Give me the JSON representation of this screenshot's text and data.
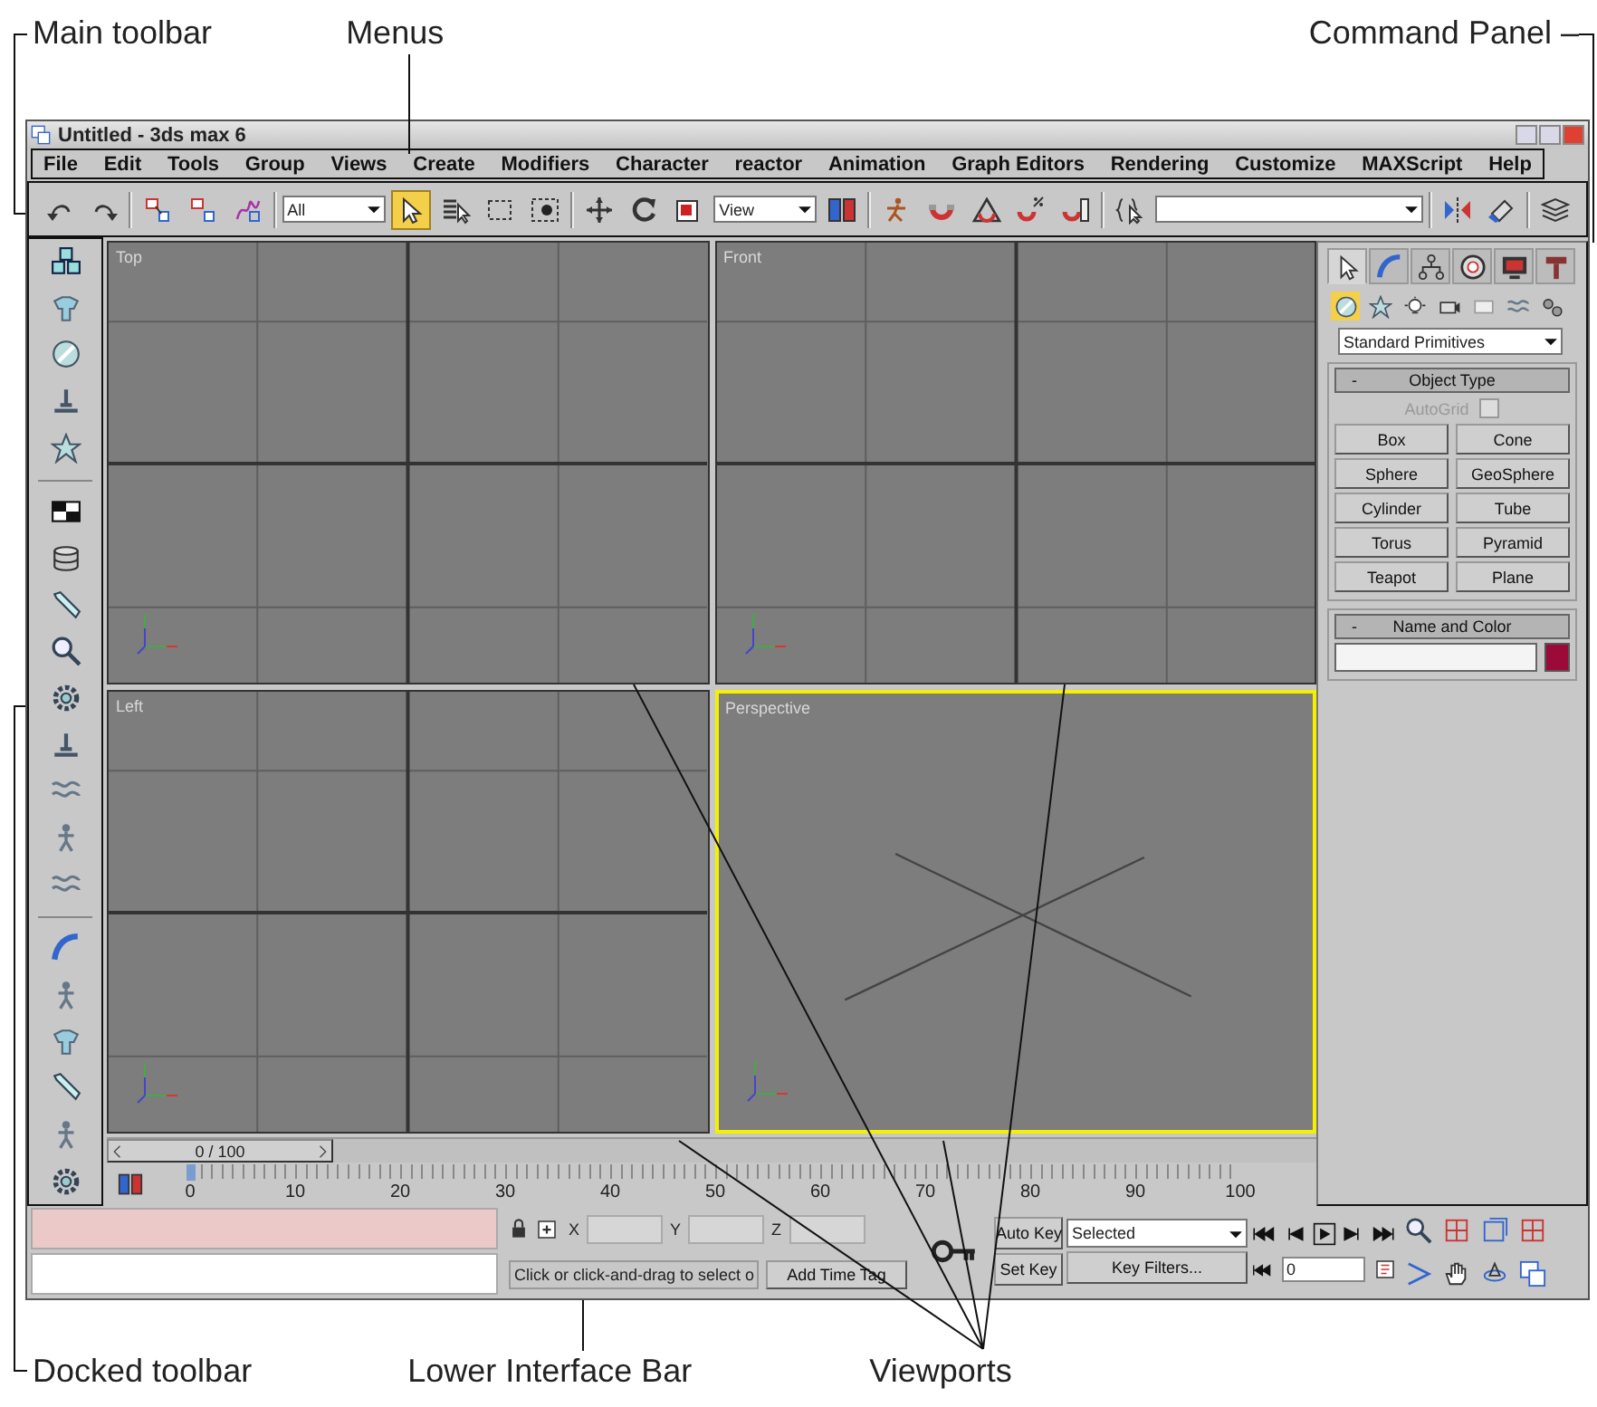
{
  "callouts": [
    {
      "label": "Main toolbar"
    },
    {
      "label": "Menus"
    },
    {
      "label": "Command Panel –"
    },
    {
      "label": "Docked toolbar"
    },
    {
      "label": "Lower Interface Bar"
    },
    {
      "label": "Viewports"
    }
  ],
  "window": {
    "title": "Untitled - 3ds max 6"
  },
  "menus": [
    "File",
    "Edit",
    "Tools",
    "Group",
    "Views",
    "Create",
    "Modifiers",
    "Character",
    "reactor",
    "Animation",
    "Graph Editors",
    "Rendering",
    "Customize",
    "MAXScript",
    "Help"
  ],
  "main_toolbar": [
    {
      "kind": "icon",
      "selected": false
    },
    {
      "kind": "icon",
      "selected": false
    },
    {
      "kind": "separator"
    },
    {
      "kind": "icon",
      "selected": false
    },
    {
      "kind": "icon",
      "selected": false
    },
    {
      "kind": "icon",
      "selected": false
    },
    {
      "kind": "separator"
    },
    {
      "kind": "dropdown",
      "value": "All"
    },
    {
      "kind": "icon",
      "selected": true
    },
    {
      "kind": "icon",
      "selected": false
    },
    {
      "kind": "icon",
      "selected": false
    },
    {
      "kind": "icon",
      "selected": false
    },
    {
      "kind": "separator"
    },
    {
      "kind": "icon",
      "selected": false
    },
    {
      "kind": "icon",
      "selected": false
    },
    {
      "kind": "icon",
      "selected": false
    },
    {
      "kind": "dropdown",
      "value": "View"
    },
    {
      "kind": "icon",
      "selected": false
    },
    {
      "kind": "separator"
    },
    {
      "kind": "icon",
      "selected": false
    },
    {
      "kind": "icon",
      "selected": false
    },
    {
      "kind": "icon",
      "selected": false
    },
    {
      "kind": "icon",
      "selected": false
    },
    {
      "kind": "icon",
      "selected": false
    },
    {
      "kind": "separator"
    },
    {
      "kind": "icon",
      "selected": false
    },
    {
      "kind": "dropdown"
    },
    {
      "kind": "separator"
    },
    {
      "kind": "icon",
      "selected": false
    },
    {
      "kind": "icon",
      "selected": false
    },
    {
      "kind": "separator"
    },
    {
      "kind": "icon",
      "selected": false
    }
  ],
  "viewports": [
    {
      "label": "Top",
      "kind": "grid",
      "active": false
    },
    {
      "label": "Front",
      "kind": "grid",
      "active": false
    },
    {
      "label": "Left",
      "kind": "grid",
      "active": false
    },
    {
      "label": "Perspective",
      "kind": "perspective",
      "active": true
    }
  ],
  "time_slider": {
    "label": "0 / 100",
    "level": 0
  },
  "track_bar": {
    "labels": [
      "0",
      "10",
      "20",
      "30",
      "40",
      "50",
      "60",
      "70",
      "80",
      "90",
      "100"
    ]
  },
  "status_bar": {
    "x_label": "X",
    "y_label": "Y",
    "z_label": "Z",
    "prompt": "Click or click-and-drag to select o",
    "add_time_tag": "Add Time Tag",
    "auto_key": {
      "label": "Auto Key",
      "on": false
    },
    "set_key": "Set Key",
    "key_mode": "Selected",
    "key_filters": "Key Filters...",
    "frame": "0"
  },
  "command_panel": {
    "tabs": [
      {
        "selected": true
      },
      {
        "selected": false
      },
      {
        "selected": false
      },
      {
        "selected": false
      },
      {
        "selected": false
      },
      {
        "selected": false
      }
    ],
    "categories": [
      {
        "selected": true
      },
      {
        "selected": false
      },
      {
        "selected": false
      },
      {
        "selected": false
      },
      {
        "selected": false
      },
      {
        "selected": false
      },
      {
        "selected": false
      }
    ],
    "dropdown": "Standard Primitives",
    "rollouts": [
      {
        "kind": "buttons",
        "toggle": "-",
        "title": "Object Type",
        "autogrid": {
          "label": "AutoGrid",
          "checked": false,
          "disabled": true
        },
        "buttons": [
          "Box",
          "Cone",
          "Sphere",
          "GeoSphere",
          "Cylinder",
          "Tube",
          "Torus",
          "Pyramid",
          "Teapot",
          "Plane"
        ]
      },
      {
        "kind": "name_color",
        "toggle": "-",
        "title": "Name and Color",
        "color": "#9c0a3a"
      }
    ]
  }
}
